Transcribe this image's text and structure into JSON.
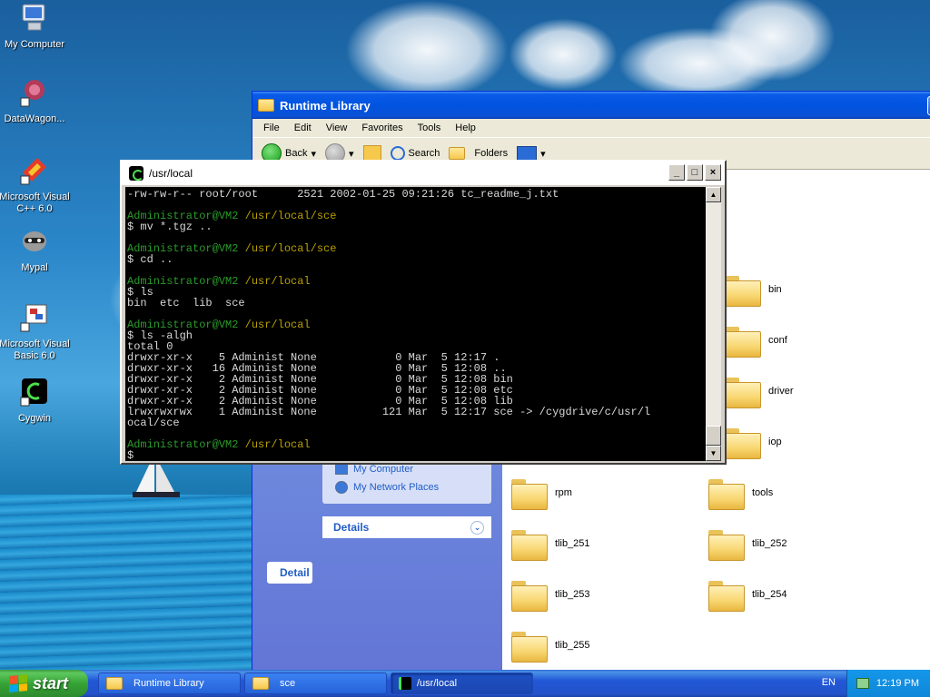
{
  "desktop": {
    "icons": [
      {
        "label": "My Computer",
        "icon": "my-computer-icon"
      },
      {
        "label": "DataWagon...",
        "icon": "datawagon-icon"
      },
      {
        "label": "Microsoft Visual C++ 6.0",
        "icon": "visual-cpp-icon"
      },
      {
        "label": "Mypal",
        "icon": "mypal-raccoon-icon"
      },
      {
        "label": "Microsoft Visual Basic 6.0",
        "icon": "visual-basic-icon"
      },
      {
        "label": "Cygwin",
        "icon": "cygwin-icon"
      }
    ]
  },
  "explorer": {
    "title": "Runtime Library",
    "menu": [
      "File",
      "Edit",
      "View",
      "Favorites",
      "Tools",
      "Help"
    ],
    "toolbar": {
      "back": "Back",
      "search": "Search",
      "folders": "Folders"
    },
    "sidebar": {
      "places_items": [
        "My Computer",
        "My Network Places"
      ],
      "details_header": "Details",
      "left_tab": "Detail"
    },
    "folders": [
      "bin",
      "conf",
      "driver",
      "iop",
      "rpm",
      "tools",
      "tlib_251",
      "tlib_252",
      "tlib_253",
      "tlib_254",
      "tlib_255"
    ]
  },
  "terminal": {
    "title": "/usr/local",
    "lines": [
      {
        "t": "-rw-rw-r-- root/root      2521 2002-01-25 09:21:26 tc_readme_j.txt",
        "c": "w"
      },
      {
        "t": "",
        "c": "w"
      },
      {
        "t": "Administrator@VM2 /usr/local/sce",
        "c": "p"
      },
      {
        "t": "$ mv *.tgz ..",
        "c": "w"
      },
      {
        "t": "",
        "c": "w"
      },
      {
        "t": "Administrator@VM2 /usr/local/sce",
        "c": "p"
      },
      {
        "t": "$ cd ..",
        "c": "w"
      },
      {
        "t": "",
        "c": "w"
      },
      {
        "t": "Administrator@VM2 /usr/local",
        "c": "p"
      },
      {
        "t": "$ ls",
        "c": "w"
      },
      {
        "t": "bin  etc  lib  sce",
        "c": "w"
      },
      {
        "t": "",
        "c": "w"
      },
      {
        "t": "Administrator@VM2 /usr/local",
        "c": "p"
      },
      {
        "t": "$ ls -algh",
        "c": "w"
      },
      {
        "t": "total 0",
        "c": "w"
      },
      {
        "t": "drwxr-xr-x    5 Administ None            0 Mar  5 12:17 .",
        "c": "w"
      },
      {
        "t": "drwxr-xr-x   16 Administ None            0 Mar  5 12:08 ..",
        "c": "w"
      },
      {
        "t": "drwxr-xr-x    2 Administ None            0 Mar  5 12:08 bin",
        "c": "w"
      },
      {
        "t": "drwxr-xr-x    2 Administ None            0 Mar  5 12:08 etc",
        "c": "w"
      },
      {
        "t": "drwxr-xr-x    2 Administ None            0 Mar  5 12:08 lib",
        "c": "w"
      },
      {
        "t": "lrwxrwxrwx    1 Administ None          121 Mar  5 12:17 sce -> /cygdrive/c/usr/l",
        "c": "w"
      },
      {
        "t": "ocal/sce",
        "c": "w"
      },
      {
        "t": "",
        "c": "w"
      },
      {
        "t": "Administrator@VM2 /usr/local",
        "c": "p"
      },
      {
        "t": "$",
        "c": "w"
      }
    ],
    "buttons": {
      "minimize": "_",
      "maximize": "□",
      "close": "×"
    }
  },
  "taskbar": {
    "start_label": "start",
    "tasks": [
      {
        "label": "Runtime Library",
        "icon": "folder-icon"
      },
      {
        "label": "sce",
        "icon": "folder-icon"
      },
      {
        "label": "/usr/local",
        "icon": "cygwin-icon"
      }
    ],
    "language": "EN",
    "clock": "12:19 PM"
  },
  "colors": {
    "prompt_user": "#2b9b2b",
    "prompt_path": "#b8a000",
    "xp_title_blue": "#0053e0",
    "start_green": "#36a436"
  }
}
